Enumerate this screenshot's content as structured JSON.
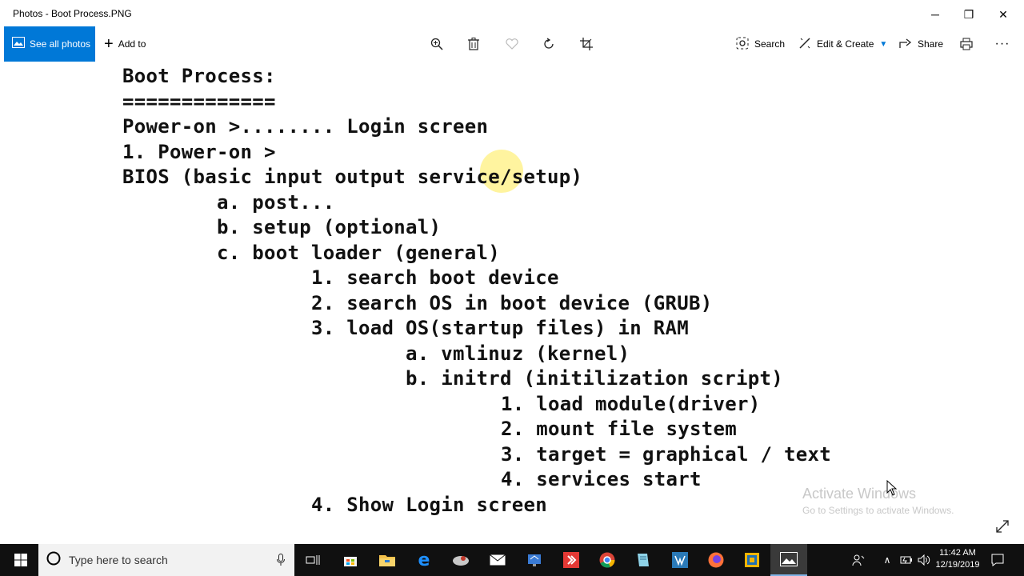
{
  "window": {
    "title": "Photos - Boot Process.PNG",
    "minimize_glyph": "─",
    "maximize_glyph": "❐",
    "close_glyph": "✕"
  },
  "toolbar": {
    "see_all_label": "See all photos",
    "add_to_label": "Add to",
    "search_label": "Search",
    "edit_create_label": "Edit & Create",
    "share_label": "Share",
    "icons": [
      "zoom-icon",
      "delete-icon",
      "favorite-icon",
      "rotate-icon",
      "crop-icon",
      "print-icon",
      "more-icon"
    ]
  },
  "document": {
    "lines": [
      "Boot Process:",
      "=============",
      "Power-on >........ Login screen",
      "1. Power-on >",
      "BIOS (basic input output service/setup)",
      "a. post...",
      "b. setup (optional)",
      "c. boot loader (general)",
      "1. search boot device",
      "2. search OS in boot device (GRUB)",
      "3. load OS(startup files) in RAM",
      "a. vmlinuz (kernel)",
      "b. initrd (initilization script)",
      "1. load module(driver)",
      "2. mount file system",
      "3. target = graphical / text",
      "4. services start",
      "4. Show Login screen"
    ]
  },
  "watermark": {
    "line1": "Activate Windows",
    "line2": "Go to Settings to activate Windows."
  },
  "taskbar": {
    "search_placeholder": "Type here to search",
    "time": "11:42 AM",
    "date": "12/19/2019",
    "accent": "#0078d7",
    "apps": [
      "task-view-icon",
      "store-icon",
      "file-explorer-icon",
      "edge-icon",
      "app-icon",
      "mail-icon",
      "network-app-icon",
      "anydesk-icon",
      "chrome-icon",
      "notepad-icon",
      "app2-icon",
      "firefox-icon",
      "vmware-icon",
      "photos-icon"
    ]
  }
}
